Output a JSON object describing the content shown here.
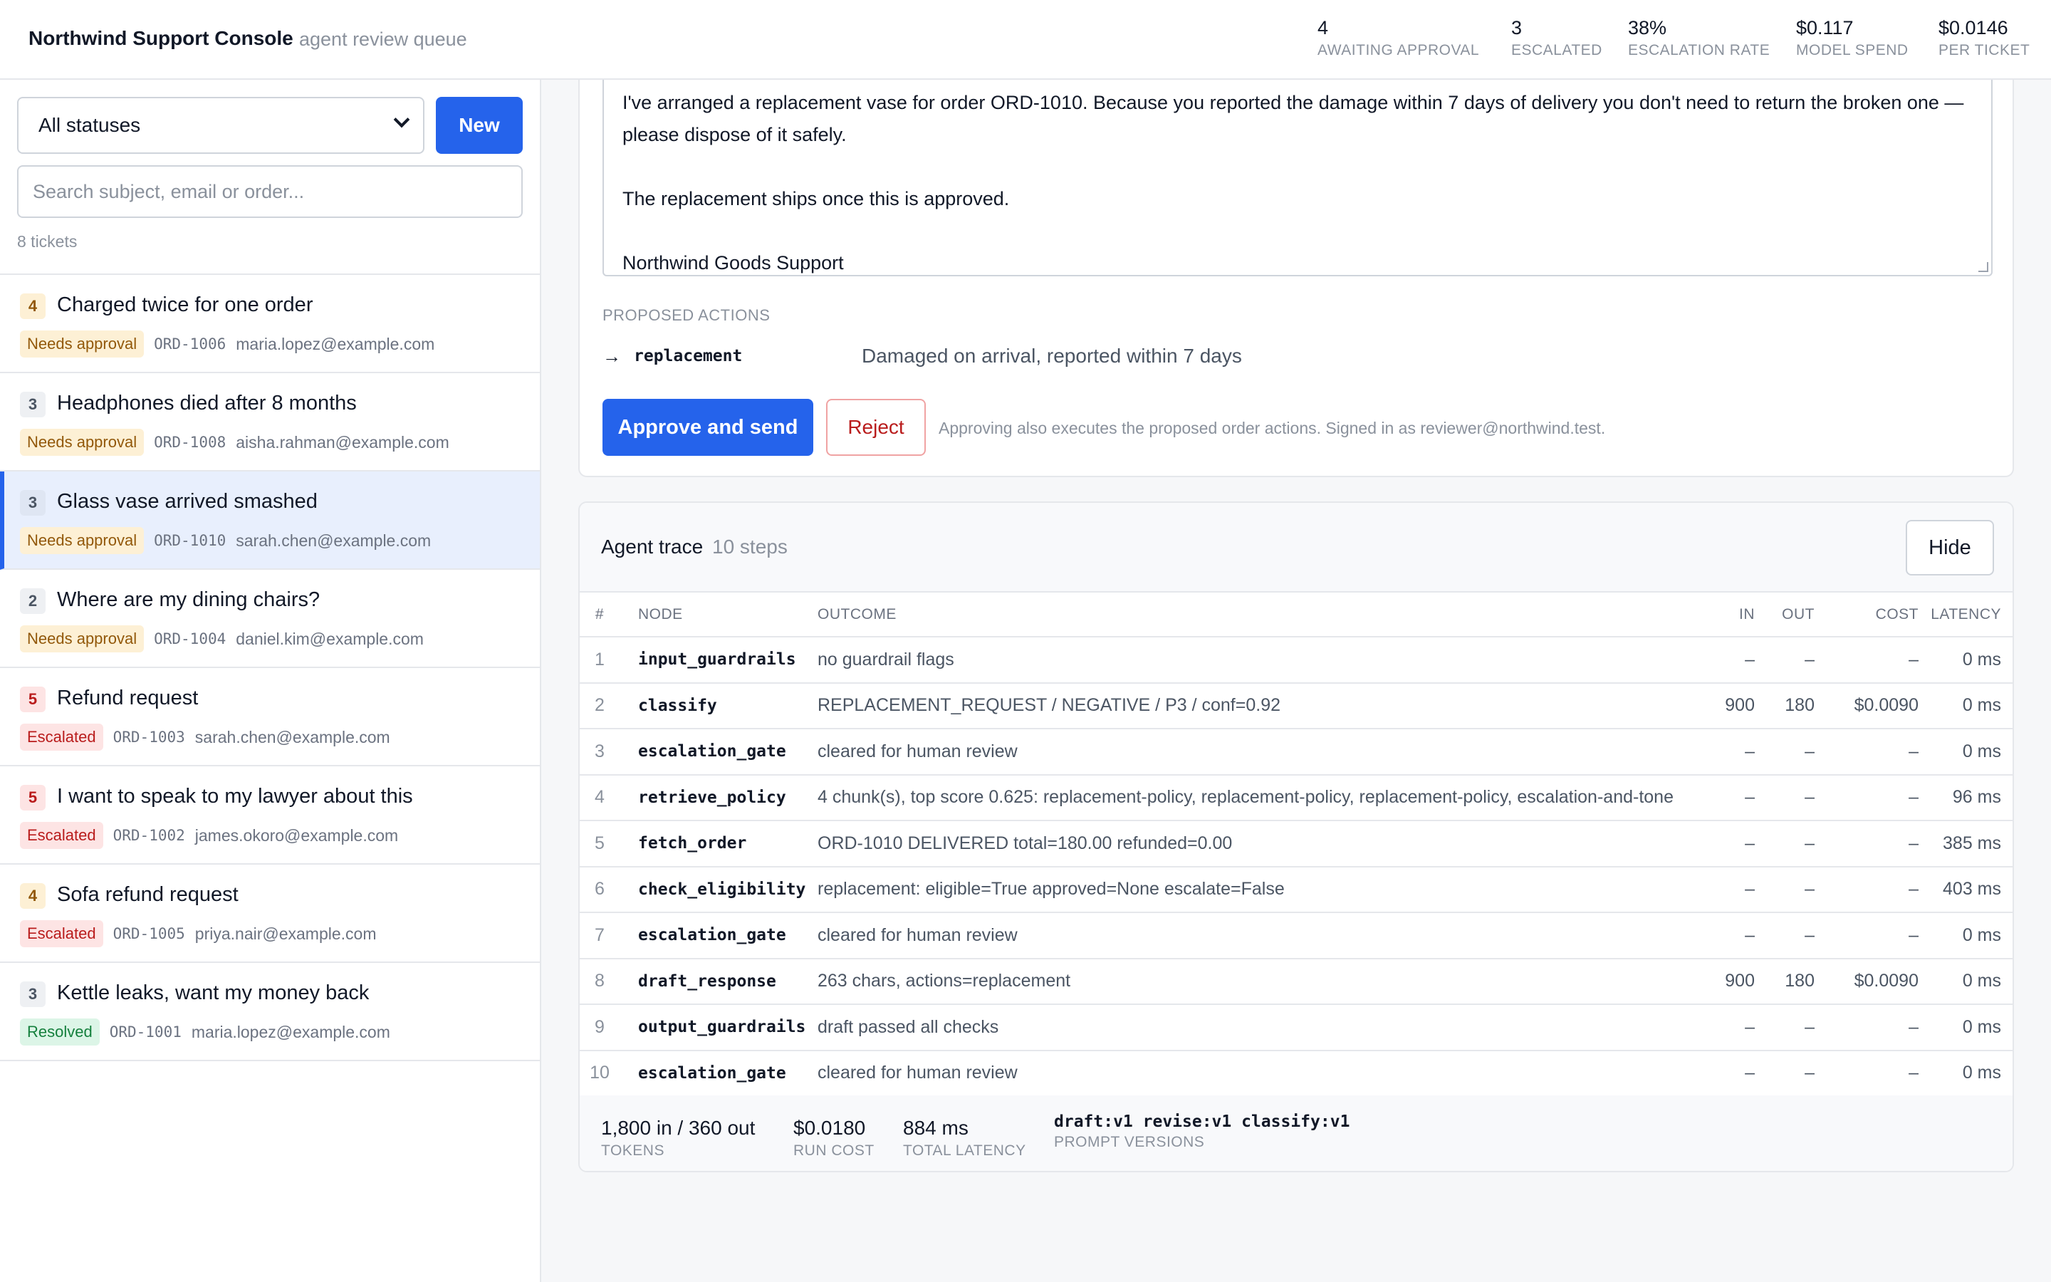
{
  "header": {
    "title": "Northwind Support Console",
    "subtitle": "agent review queue",
    "stats": [
      {
        "value": "4",
        "label": "AWAITING APPROVAL"
      },
      {
        "value": "3",
        "label": "ESCALATED"
      },
      {
        "value": "38%",
        "label": "ESCALATION RATE"
      },
      {
        "value": "$0.117",
        "label": "MODEL SPEND"
      },
      {
        "value": "$0.0146",
        "label": "PER TICKET"
      }
    ]
  },
  "sidebar": {
    "status_filter": "All statuses",
    "new_label": "New",
    "search_placeholder": "Search subject, email or order...",
    "ticket_count": "8 tickets",
    "tickets": [
      {
        "priority": "4",
        "subject": "Charged twice for one order",
        "status": "Needs approval",
        "order": "ORD-1006",
        "email": "maria.lopez@example.com"
      },
      {
        "priority": "3",
        "subject": "Headphones died after 8 months",
        "status": "Needs approval",
        "order": "ORD-1008",
        "email": "aisha.rahman@example.com"
      },
      {
        "priority": "3",
        "subject": "Glass vase arrived smashed",
        "status": "Needs approval",
        "order": "ORD-1010",
        "email": "sarah.chen@example.com"
      },
      {
        "priority": "2",
        "subject": "Where are my dining chairs?",
        "status": "Needs approval",
        "order": "ORD-1004",
        "email": "daniel.kim@example.com"
      },
      {
        "priority": "5",
        "subject": "Refund request",
        "status": "Escalated",
        "order": "ORD-1003",
        "email": "sarah.chen@example.com"
      },
      {
        "priority": "5",
        "subject": "I want to speak to my lawyer about this",
        "status": "Escalated",
        "order": "ORD-1002",
        "email": "james.okoro@example.com"
      },
      {
        "priority": "4",
        "subject": "Sofa refund request",
        "status": "Escalated",
        "order": "ORD-1005",
        "email": "priya.nair@example.com"
      },
      {
        "priority": "3",
        "subject": "Kettle leaks, want my money back",
        "status": "Resolved",
        "order": "ORD-1001",
        "email": "maria.lopez@example.com"
      }
    ]
  },
  "draft": {
    "para1": "I've arranged a replacement vase for order ORD-1010. Because you reported the damage within 7 days of delivery you don't need to return the broken one — please dispose of it safely.",
    "para2": "The replacement ships once this is approved.",
    "para3": "Northwind Goods Support"
  },
  "actions": {
    "label": "PROPOSED ACTIONS",
    "arrow": "→",
    "name": "replacement",
    "reason": "Damaged on arrival, reported within 7 days",
    "approve_label": "Approve and send",
    "reject_label": "Reject",
    "note": "Approving also executes the proposed order actions. Signed in as reviewer@northwind.test."
  },
  "trace": {
    "title": "Agent trace",
    "steps": "10 steps",
    "hide_label": "Hide",
    "columns": {
      "num": "#",
      "node": "NODE",
      "outcome": "OUTCOME",
      "in": "IN",
      "out": "OUT",
      "cost": "COST",
      "latency": "LATENCY"
    },
    "rows": [
      {
        "n": "1",
        "node": "input_guardrails",
        "outcome": "no guardrail flags",
        "in": "–",
        "out": "–",
        "cost": "–",
        "latency": "0 ms"
      },
      {
        "n": "2",
        "node": "classify",
        "outcome": "REPLACEMENT_REQUEST / NEGATIVE / P3 / conf=0.92",
        "in": "900",
        "out": "180",
        "cost": "$0.0090",
        "latency": "0 ms"
      },
      {
        "n": "3",
        "node": "escalation_gate",
        "outcome": "cleared for human review",
        "in": "–",
        "out": "–",
        "cost": "–",
        "latency": "0 ms"
      },
      {
        "n": "4",
        "node": "retrieve_policy",
        "outcome": "4 chunk(s), top score 0.625: replacement-policy, replacement-policy, replacement-policy, escalation-and-tone",
        "in": "–",
        "out": "–",
        "cost": "–",
        "latency": "96 ms"
      },
      {
        "n": "5",
        "node": "fetch_order",
        "outcome": "ORD-1010 DELIVERED total=180.00 refunded=0.00",
        "in": "–",
        "out": "–",
        "cost": "–",
        "latency": "385 ms"
      },
      {
        "n": "6",
        "node": "check_eligibility",
        "outcome": "replacement: eligible=True approved=None escalate=False",
        "in": "–",
        "out": "–",
        "cost": "–",
        "latency": "403 ms"
      },
      {
        "n": "7",
        "node": "escalation_gate",
        "outcome": "cleared for human review",
        "in": "–",
        "out": "–",
        "cost": "–",
        "latency": "0 ms"
      },
      {
        "n": "8",
        "node": "draft_response",
        "outcome": "263 chars, actions=replacement",
        "in": "900",
        "out": "180",
        "cost": "$0.0090",
        "latency": "0 ms"
      },
      {
        "n": "9",
        "node": "output_guardrails",
        "outcome": "draft passed all checks",
        "in": "–",
        "out": "–",
        "cost": "–",
        "latency": "0 ms"
      },
      {
        "n": "10",
        "node": "escalation_gate",
        "outcome": "cleared for human review",
        "in": "–",
        "out": "–",
        "cost": "–",
        "latency": "0 ms"
      }
    ],
    "footer": [
      {
        "value": "1,800 in / 360 out",
        "label": "TOKENS"
      },
      {
        "value": "$0.0180",
        "label": "RUN COST"
      },
      {
        "value": "884 ms",
        "label": "TOTAL LATENCY"
      },
      {
        "value": "draft:v1 revise:v1 classify:v1",
        "label": "PROMPT VERSIONS"
      }
    ]
  },
  "colors": {
    "accent": "#2563eb",
    "needs_approval_bg": "#fdf0d5",
    "needs_approval_fg": "#92580a",
    "escalated_bg": "#fde4e4",
    "escalated_fg": "#b91c1c",
    "resolved_bg": "#dcf5e7",
    "resolved_fg": "#15803d"
  }
}
